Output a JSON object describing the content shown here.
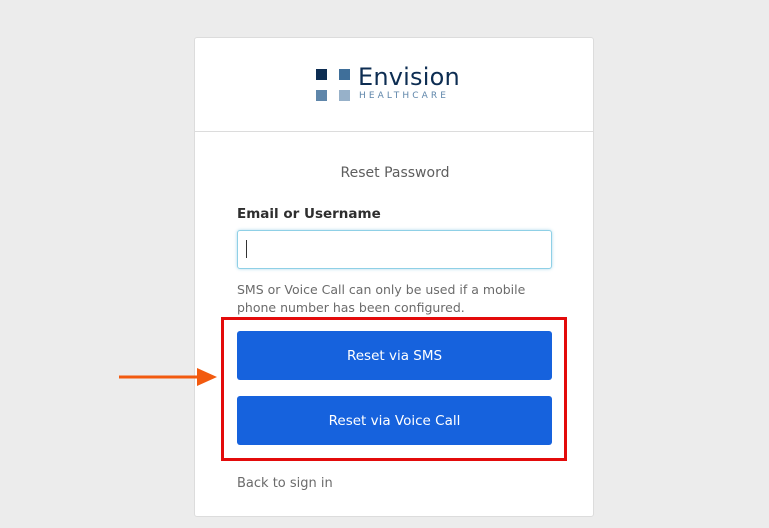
{
  "colors": {
    "background": "#ececec",
    "primary_button": "#1662dd",
    "brand_navy": "#0d2d52",
    "highlight_box": "#e30b0b",
    "annotation_arrow": "#f25a0f"
  },
  "brand": {
    "name": "Envision",
    "tagline": "HEALTHCARE"
  },
  "form": {
    "title": "Reset Password",
    "field_label": "Email or Username",
    "field_value": "",
    "hint": "SMS or Voice Call can only be used if a mobile phone number has been configured.",
    "sms_button": "Reset via SMS",
    "voice_button": "Reset via Voice Call",
    "back_link": "Back to sign in"
  }
}
